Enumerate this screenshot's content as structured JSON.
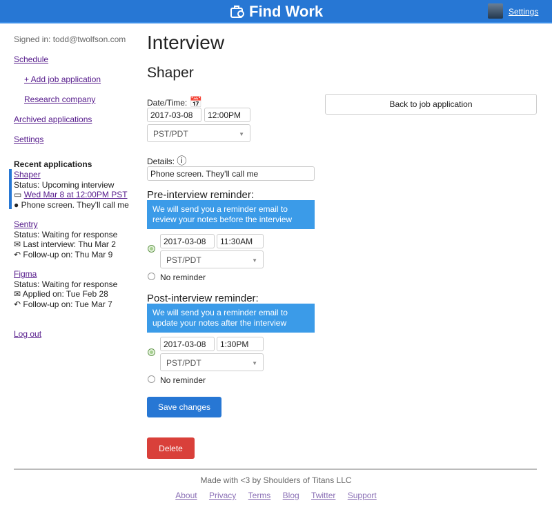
{
  "header": {
    "title": "Find Work",
    "settings": "Settings"
  },
  "sidebar": {
    "signed_in": "Signed in: todd@twolfson.com",
    "schedule": "Schedule",
    "add_job": "+ Add job application",
    "research": "Research company",
    "archived": "Archived applications",
    "settings": "Settings",
    "recent_title": "Recent applications",
    "logout": "Log out",
    "recent": [
      {
        "name": "Shaper",
        "status": "Status: Upcoming interview",
        "line1": "Wed Mar 8 at 12:00PM PST",
        "line2": "Phone screen. They'll call me"
      },
      {
        "name": "Sentry",
        "status": "Status: Waiting for response",
        "line1": "Last interview: Thu Mar 2",
        "line2": "Follow-up on: Thu Mar 9"
      },
      {
        "name": "Figma",
        "status": "Status: Waiting for response",
        "line1": "Applied on: Tue Feb 28",
        "line2": "Follow-up on: Tue Mar 7"
      }
    ]
  },
  "main": {
    "title": "Interview",
    "company": "Shaper",
    "datetime_label": "Date/Time:",
    "date": "2017-03-08",
    "time": "12:00PM",
    "tz": "PST/PDT",
    "details_label": "Details:",
    "details": "Phone screen. They'll call me",
    "back": "Back to job application",
    "pre": {
      "title": "Pre-interview reminder:",
      "note": "We will send you a reminder email to review your notes before the interview",
      "date": "2017-03-08",
      "time": "11:30AM",
      "tz": "PST/PDT",
      "none": "No reminder"
    },
    "post": {
      "title": "Post-interview reminder:",
      "note": "We will send you a reminder email to update your notes after the interview",
      "date": "2017-03-08",
      "time": "1:30PM",
      "tz": "PST/PDT",
      "none": "No reminder"
    },
    "save": "Save changes",
    "delete": "Delete"
  },
  "footer": {
    "made": "Made with <3 by Shoulders of Titans LLC",
    "links": [
      "About",
      "Privacy",
      "Terms",
      "Blog",
      "Twitter",
      "Support"
    ]
  },
  "colors": {
    "header": "#2777d4",
    "note": "#3b9be8",
    "save": "#2777d4",
    "delete": "#d9403a"
  }
}
